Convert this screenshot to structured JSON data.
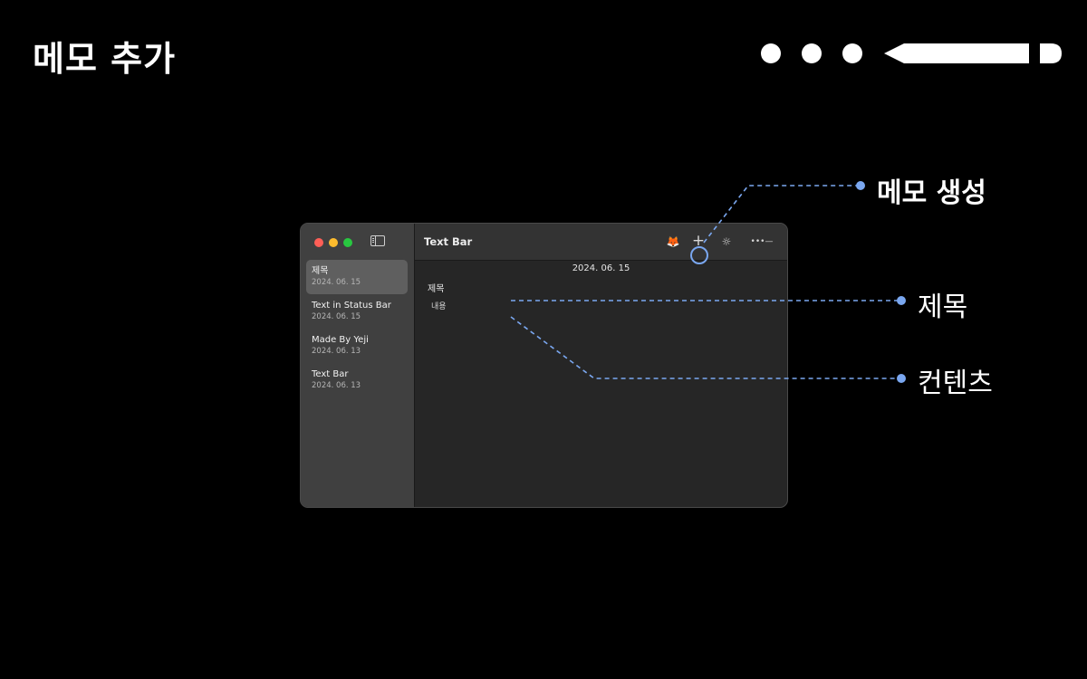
{
  "slide": {
    "title": "메모 추가"
  },
  "window": {
    "toolbar_title": "Text Bar",
    "notes": [
      {
        "title": "제목",
        "date": "2024. 06. 15",
        "selected": true
      },
      {
        "title": "Text in Status Bar",
        "date": "2024. 06. 15"
      },
      {
        "title": "Made By Yeji",
        "date": "2024. 06. 13"
      },
      {
        "title": "Text Bar",
        "date": "2024. 06. 13"
      }
    ],
    "editor": {
      "date": "2024. 06. 15",
      "title": "제목",
      "body": "내용"
    },
    "toolbar_icons": [
      "fox-icon",
      "plus-icon",
      "sun-icon",
      "more-icon"
    ]
  },
  "annotations": {
    "create": "메모 생성",
    "title": "제목",
    "content": "컨텐츠",
    "line_color": "#7aa7f0"
  }
}
